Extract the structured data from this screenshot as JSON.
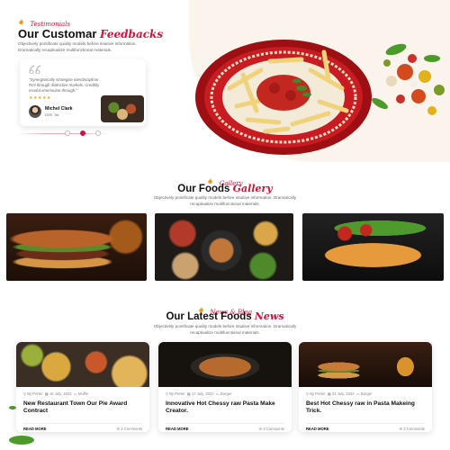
{
  "testimonials": {
    "kicker": "Testimonials",
    "title_main": "Our Customar",
    "title_accent": "Feedbacks",
    "description_1": "Objectively pontificate quality models before intuitive information.",
    "description_2": "Dramatically recaptiualize multifunctional materials.",
    "quote_1": "\"Synergistically strategize interdisciplinar",
    "quote_2": "ROI through distinctive markets. Credibly",
    "quote_3": "revolut emerinuine through.\"",
    "stars": "★★★★★",
    "reviewer_name": "Michel Clark",
    "reviewer_role": "DVE, Dir.",
    "slider_count": 3,
    "active_index": 1
  },
  "gallery": {
    "kicker": "Gallery",
    "title_main": "Our Foods",
    "title_accent": "Gallery",
    "description_1": "Objectively pontificate quality models before intuitive information. Dramatically",
    "description_2": "recaptiualize multifunctional materials."
  },
  "news": {
    "kicker": "News & Blog",
    "title_main": "Our Latest Foods",
    "title_accent": "News",
    "description_1": "Objectively pontificate quality models before intuitive information. Dramatically",
    "description_2": "recaptiualize multifunctional materials.",
    "read_more": "READ MORE",
    "articles": [
      {
        "title": "New Restaurant Town Our Pie Award Contract",
        "author": "By Petter",
        "date": "16 July, 2022",
        "category": "Muffin",
        "comments": "3 Comments"
      },
      {
        "title": "Innovative Hot Chessy raw Pasta Make Creator.",
        "author": "By Petter",
        "date": "17 July, 2022",
        "category": "Burger",
        "comments": "3 Comments"
      },
      {
        "title": "Best Hot Chessy raw in Pasta Makeing Trick.",
        "author": "By Petter",
        "date": "21 July, 2022",
        "category": "Burger",
        "comments": "3 Comments"
      }
    ]
  },
  "colors": {
    "accent": "#d6113b",
    "dark": "#111111",
    "cream": "#faf4ec"
  }
}
